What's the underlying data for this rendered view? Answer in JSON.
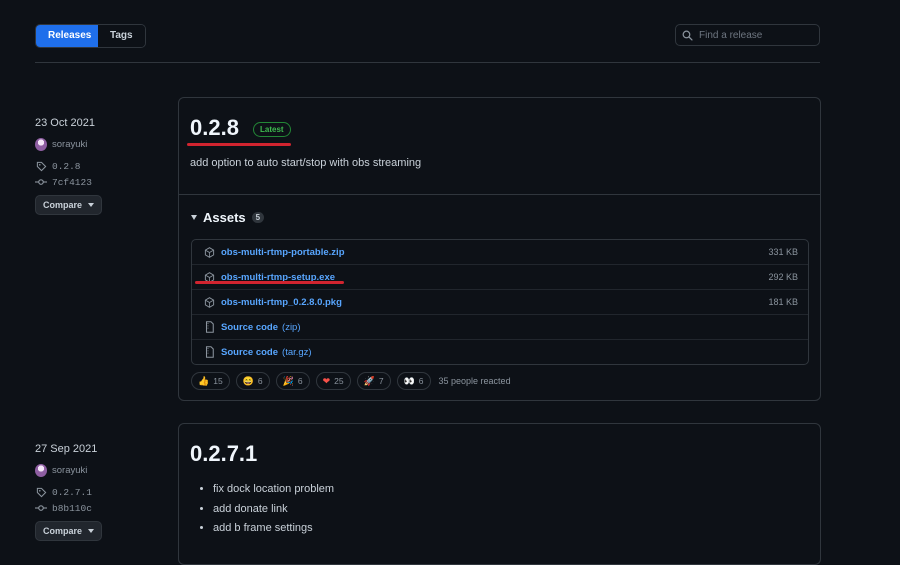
{
  "toolbar": {
    "releases_label": "Releases",
    "tags_label": "Tags",
    "search_placeholder": "Find a release",
    "search_icon": "search-icon"
  },
  "colors": {
    "background": "#0d1117",
    "accent": "#1f6feb",
    "link": "#58a6ff",
    "latest_badge": "#3fb950",
    "annotation_underline": "#d1242f"
  },
  "releases": [
    {
      "date": "23 Oct 2021",
      "author": "sorayuki",
      "tag": "0.2.8",
      "commit": "7cf4123",
      "compare_label": "Compare",
      "version": "0.2.8",
      "badge": "Latest",
      "description": "add option to auto start/stop with obs streaming",
      "assets_title": "Assets",
      "assets_count": "5",
      "assets": [
        {
          "name": "obs-multi-rtmp-portable.zip",
          "ext": "",
          "size": "331 KB",
          "icon": "package-icon"
        },
        {
          "name": "obs-multi-rtmp-setup.exe",
          "ext": "",
          "size": "292 KB",
          "icon": "package-icon"
        },
        {
          "name": "obs-multi-rtmp_0.2.8.0.pkg",
          "ext": "",
          "size": "181 KB",
          "icon": "package-icon"
        },
        {
          "name": "Source code",
          "ext": "(zip)",
          "size": "",
          "icon": "file-zip-icon"
        },
        {
          "name": "Source code",
          "ext": "(tar.gz)",
          "size": "",
          "icon": "file-zip-icon"
        }
      ],
      "reactions": [
        {
          "emoji": "👍",
          "count": "15",
          "icon": "thumbs-up-icon"
        },
        {
          "emoji": "😄",
          "count": "6",
          "icon": "smile-icon"
        },
        {
          "emoji": "🎉",
          "count": "6",
          "icon": "tada-icon"
        },
        {
          "emoji": "❤",
          "count": "25",
          "icon": "heart-icon"
        },
        {
          "emoji": "🚀",
          "count": "7",
          "icon": "rocket-icon"
        },
        {
          "emoji": "👀",
          "count": "6",
          "icon": "eyes-icon"
        }
      ],
      "reacted_text": "35 people reacted"
    },
    {
      "date": "27 Sep 2021",
      "author": "sorayuki",
      "tag": "0.2.7.1",
      "commit": "b8b110c",
      "compare_label": "Compare",
      "version": "0.2.7.1",
      "notes": [
        "fix dock location problem",
        "add donate link",
        "add b frame settings"
      ]
    }
  ]
}
